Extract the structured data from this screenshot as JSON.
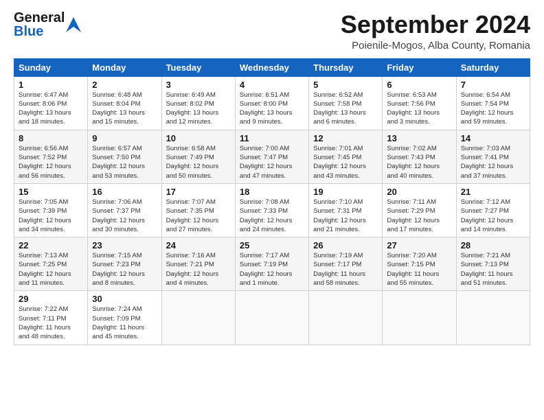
{
  "header": {
    "logo": {
      "line1": "General",
      "line2": "Blue"
    },
    "title": "September 2024",
    "location": "Poienile-Mogos, Alba County, Romania"
  },
  "weekdays": [
    "Sunday",
    "Monday",
    "Tuesday",
    "Wednesday",
    "Thursday",
    "Friday",
    "Saturday"
  ],
  "weeks": [
    [
      {
        "day": "1",
        "info": "Sunrise: 6:47 AM\nSunset: 8:06 PM\nDaylight: 13 hours\nand 18 minutes."
      },
      {
        "day": "2",
        "info": "Sunrise: 6:48 AM\nSunset: 8:04 PM\nDaylight: 13 hours\nand 15 minutes."
      },
      {
        "day": "3",
        "info": "Sunrise: 6:49 AM\nSunset: 8:02 PM\nDaylight: 13 hours\nand 12 minutes."
      },
      {
        "day": "4",
        "info": "Sunrise: 6:51 AM\nSunset: 8:00 PM\nDaylight: 13 hours\nand 9 minutes."
      },
      {
        "day": "5",
        "info": "Sunrise: 6:52 AM\nSunset: 7:58 PM\nDaylight: 13 hours\nand 6 minutes."
      },
      {
        "day": "6",
        "info": "Sunrise: 6:53 AM\nSunset: 7:56 PM\nDaylight: 13 hours\nand 3 minutes."
      },
      {
        "day": "7",
        "info": "Sunrise: 6:54 AM\nSunset: 7:54 PM\nDaylight: 12 hours\nand 59 minutes."
      }
    ],
    [
      {
        "day": "8",
        "info": "Sunrise: 6:56 AM\nSunset: 7:52 PM\nDaylight: 12 hours\nand 56 minutes."
      },
      {
        "day": "9",
        "info": "Sunrise: 6:57 AM\nSunset: 7:50 PM\nDaylight: 12 hours\nand 53 minutes."
      },
      {
        "day": "10",
        "info": "Sunrise: 6:58 AM\nSunset: 7:49 PM\nDaylight: 12 hours\nand 50 minutes."
      },
      {
        "day": "11",
        "info": "Sunrise: 7:00 AM\nSunset: 7:47 PM\nDaylight: 12 hours\nand 47 minutes."
      },
      {
        "day": "12",
        "info": "Sunrise: 7:01 AM\nSunset: 7:45 PM\nDaylight: 12 hours\nand 43 minutes."
      },
      {
        "day": "13",
        "info": "Sunrise: 7:02 AM\nSunset: 7:43 PM\nDaylight: 12 hours\nand 40 minutes."
      },
      {
        "day": "14",
        "info": "Sunrise: 7:03 AM\nSunset: 7:41 PM\nDaylight: 12 hours\nand 37 minutes."
      }
    ],
    [
      {
        "day": "15",
        "info": "Sunrise: 7:05 AM\nSunset: 7:39 PM\nDaylight: 12 hours\nand 34 minutes."
      },
      {
        "day": "16",
        "info": "Sunrise: 7:06 AM\nSunset: 7:37 PM\nDaylight: 12 hours\nand 30 minutes."
      },
      {
        "day": "17",
        "info": "Sunrise: 7:07 AM\nSunset: 7:35 PM\nDaylight: 12 hours\nand 27 minutes."
      },
      {
        "day": "18",
        "info": "Sunrise: 7:08 AM\nSunset: 7:33 PM\nDaylight: 12 hours\nand 24 minutes."
      },
      {
        "day": "19",
        "info": "Sunrise: 7:10 AM\nSunset: 7:31 PM\nDaylight: 12 hours\nand 21 minutes."
      },
      {
        "day": "20",
        "info": "Sunrise: 7:11 AM\nSunset: 7:29 PM\nDaylight: 12 hours\nand 17 minutes."
      },
      {
        "day": "21",
        "info": "Sunrise: 7:12 AM\nSunset: 7:27 PM\nDaylight: 12 hours\nand 14 minutes."
      }
    ],
    [
      {
        "day": "22",
        "info": "Sunrise: 7:13 AM\nSunset: 7:25 PM\nDaylight: 12 hours\nand 11 minutes."
      },
      {
        "day": "23",
        "info": "Sunrise: 7:15 AM\nSunset: 7:23 PM\nDaylight: 12 hours\nand 8 minutes."
      },
      {
        "day": "24",
        "info": "Sunrise: 7:16 AM\nSunset: 7:21 PM\nDaylight: 12 hours\nand 4 minutes."
      },
      {
        "day": "25",
        "info": "Sunrise: 7:17 AM\nSunset: 7:19 PM\nDaylight: 12 hours\nand 1 minute."
      },
      {
        "day": "26",
        "info": "Sunrise: 7:19 AM\nSunset: 7:17 PM\nDaylight: 11 hours\nand 58 minutes."
      },
      {
        "day": "27",
        "info": "Sunrise: 7:20 AM\nSunset: 7:15 PM\nDaylight: 11 hours\nand 55 minutes."
      },
      {
        "day": "28",
        "info": "Sunrise: 7:21 AM\nSunset: 7:13 PM\nDaylight: 11 hours\nand 51 minutes."
      }
    ],
    [
      {
        "day": "29",
        "info": "Sunrise: 7:22 AM\nSunset: 7:11 PM\nDaylight: 11 hours\nand 48 minutes."
      },
      {
        "day": "30",
        "info": "Sunrise: 7:24 AM\nSunset: 7:09 PM\nDaylight: 11 hours\nand 45 minutes."
      },
      {
        "day": "",
        "info": ""
      },
      {
        "day": "",
        "info": ""
      },
      {
        "day": "",
        "info": ""
      },
      {
        "day": "",
        "info": ""
      },
      {
        "day": "",
        "info": ""
      }
    ]
  ]
}
